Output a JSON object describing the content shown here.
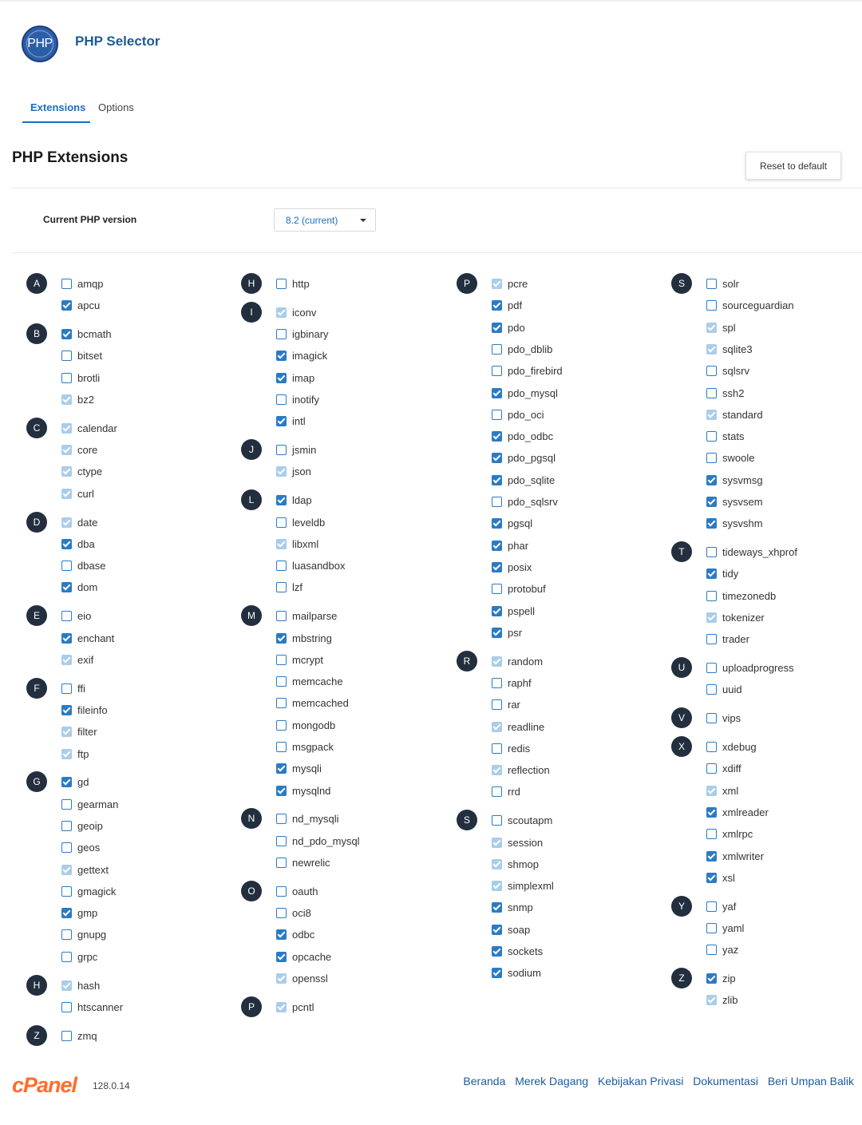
{
  "header": {
    "app_title": "PHP Selector",
    "logo_text": "PHP"
  },
  "tabs": [
    {
      "label": "Extensions",
      "active": true
    },
    {
      "label": "Options",
      "active": false
    }
  ],
  "section_title": "PHP Extensions",
  "reset_button": "Reset to default",
  "version": {
    "label": "Current PHP version",
    "selected": "8.2 (current)"
  },
  "columns": [
    [
      {
        "letter": "A",
        "items": [
          {
            "name": "amqp",
            "state": "unchecked"
          },
          {
            "name": "apcu",
            "state": "checked"
          }
        ]
      },
      {
        "letter": "B",
        "items": [
          {
            "name": "bcmath",
            "state": "checked"
          },
          {
            "name": "bitset",
            "state": "unchecked"
          },
          {
            "name": "brotli",
            "state": "unchecked"
          },
          {
            "name": "bz2",
            "state": "checked-disabled"
          }
        ]
      },
      {
        "letter": "C",
        "items": [
          {
            "name": "calendar",
            "state": "checked-disabled"
          },
          {
            "name": "core",
            "state": "checked-disabled"
          },
          {
            "name": "ctype",
            "state": "checked-disabled"
          },
          {
            "name": "curl",
            "state": "checked-disabled"
          }
        ]
      },
      {
        "letter": "D",
        "items": [
          {
            "name": "date",
            "state": "checked-disabled"
          },
          {
            "name": "dba",
            "state": "checked"
          },
          {
            "name": "dbase",
            "state": "unchecked"
          },
          {
            "name": "dom",
            "state": "checked"
          }
        ]
      },
      {
        "letter": "E",
        "items": [
          {
            "name": "eio",
            "state": "unchecked"
          },
          {
            "name": "enchant",
            "state": "checked"
          },
          {
            "name": "exif",
            "state": "checked-disabled"
          }
        ]
      },
      {
        "letter": "F",
        "items": [
          {
            "name": "ffi",
            "state": "unchecked"
          },
          {
            "name": "fileinfo",
            "state": "checked"
          },
          {
            "name": "filter",
            "state": "checked-disabled"
          },
          {
            "name": "ftp",
            "state": "checked-disabled"
          }
        ]
      },
      {
        "letter": "G",
        "items": [
          {
            "name": "gd",
            "state": "checked"
          },
          {
            "name": "gearman",
            "state": "unchecked"
          },
          {
            "name": "geoip",
            "state": "unchecked"
          },
          {
            "name": "geos",
            "state": "unchecked"
          },
          {
            "name": "gettext",
            "state": "checked-disabled"
          },
          {
            "name": "gmagick",
            "state": "unchecked"
          },
          {
            "name": "gmp",
            "state": "checked"
          },
          {
            "name": "gnupg",
            "state": "unchecked"
          },
          {
            "name": "grpc",
            "state": "unchecked"
          }
        ]
      },
      {
        "letter": "H",
        "items": [
          {
            "name": "hash",
            "state": "checked-disabled"
          },
          {
            "name": "htscanner",
            "state": "unchecked"
          }
        ]
      },
      {
        "letter": "Z",
        "items": [
          {
            "name": "zmq",
            "state": "unchecked"
          }
        ]
      }
    ],
    [
      {
        "letter": "H",
        "items": [
          {
            "name": "http",
            "state": "unchecked"
          }
        ]
      },
      {
        "letter": "I",
        "items": [
          {
            "name": "iconv",
            "state": "checked-disabled"
          },
          {
            "name": "igbinary",
            "state": "unchecked"
          },
          {
            "name": "imagick",
            "state": "checked"
          },
          {
            "name": "imap",
            "state": "checked"
          },
          {
            "name": "inotify",
            "state": "unchecked"
          },
          {
            "name": "intl",
            "state": "checked"
          }
        ]
      },
      {
        "letter": "J",
        "items": [
          {
            "name": "jsmin",
            "state": "unchecked"
          },
          {
            "name": "json",
            "state": "checked-disabled"
          }
        ]
      },
      {
        "letter": "L",
        "items": [
          {
            "name": "ldap",
            "state": "checked"
          },
          {
            "name": "leveldb",
            "state": "unchecked"
          },
          {
            "name": "libxml",
            "state": "checked-disabled"
          },
          {
            "name": "luasandbox",
            "state": "unchecked"
          },
          {
            "name": "lzf",
            "state": "unchecked"
          }
        ]
      },
      {
        "letter": "M",
        "items": [
          {
            "name": "mailparse",
            "state": "unchecked"
          },
          {
            "name": "mbstring",
            "state": "checked"
          },
          {
            "name": "mcrypt",
            "state": "unchecked"
          },
          {
            "name": "memcache",
            "state": "unchecked"
          },
          {
            "name": "memcached",
            "state": "unchecked"
          },
          {
            "name": "mongodb",
            "state": "unchecked"
          },
          {
            "name": "msgpack",
            "state": "unchecked"
          },
          {
            "name": "mysqli",
            "state": "checked"
          },
          {
            "name": "mysqlnd",
            "state": "checked"
          }
        ]
      },
      {
        "letter": "N",
        "items": [
          {
            "name": "nd_mysqli",
            "state": "unchecked"
          },
          {
            "name": "nd_pdo_mysql",
            "state": "unchecked"
          },
          {
            "name": "newrelic",
            "state": "unchecked"
          }
        ]
      },
      {
        "letter": "O",
        "items": [
          {
            "name": "oauth",
            "state": "unchecked"
          },
          {
            "name": "oci8",
            "state": "unchecked"
          },
          {
            "name": "odbc",
            "state": "checked"
          },
          {
            "name": "opcache",
            "state": "checked"
          },
          {
            "name": "openssl",
            "state": "checked-disabled"
          }
        ]
      },
      {
        "letter": "P",
        "items": [
          {
            "name": "pcntl",
            "state": "checked-disabled"
          }
        ]
      }
    ],
    [
      {
        "letter": "P",
        "items": [
          {
            "name": "pcre",
            "state": "checked-disabled"
          },
          {
            "name": "pdf",
            "state": "checked"
          },
          {
            "name": "pdo",
            "state": "checked"
          },
          {
            "name": "pdo_dblib",
            "state": "unchecked"
          },
          {
            "name": "pdo_firebird",
            "state": "unchecked"
          },
          {
            "name": "pdo_mysql",
            "state": "checked"
          },
          {
            "name": "pdo_oci",
            "state": "unchecked"
          },
          {
            "name": "pdo_odbc",
            "state": "checked"
          },
          {
            "name": "pdo_pgsql",
            "state": "checked"
          },
          {
            "name": "pdo_sqlite",
            "state": "checked"
          },
          {
            "name": "pdo_sqlsrv",
            "state": "unchecked"
          },
          {
            "name": "pgsql",
            "state": "checked"
          },
          {
            "name": "phar",
            "state": "checked"
          },
          {
            "name": "posix",
            "state": "checked"
          },
          {
            "name": "protobuf",
            "state": "unchecked"
          },
          {
            "name": "pspell",
            "state": "checked"
          },
          {
            "name": "psr",
            "state": "checked"
          }
        ]
      },
      {
        "letter": "R",
        "items": [
          {
            "name": "random",
            "state": "checked-disabled"
          },
          {
            "name": "raphf",
            "state": "unchecked"
          },
          {
            "name": "rar",
            "state": "unchecked"
          },
          {
            "name": "readline",
            "state": "checked-disabled"
          },
          {
            "name": "redis",
            "state": "unchecked"
          },
          {
            "name": "reflection",
            "state": "checked-disabled"
          },
          {
            "name": "rrd",
            "state": "unchecked"
          }
        ]
      },
      {
        "letter": "S",
        "items": [
          {
            "name": "scoutapm",
            "state": "unchecked"
          },
          {
            "name": "session",
            "state": "checked-disabled"
          },
          {
            "name": "shmop",
            "state": "checked-disabled"
          },
          {
            "name": "simplexml",
            "state": "checked-disabled"
          },
          {
            "name": "snmp",
            "state": "checked"
          },
          {
            "name": "soap",
            "state": "checked"
          },
          {
            "name": "sockets",
            "state": "checked"
          },
          {
            "name": "sodium",
            "state": "checked"
          }
        ]
      }
    ],
    [
      {
        "letter": "S",
        "items": [
          {
            "name": "solr",
            "state": "unchecked"
          },
          {
            "name": "sourceguardian",
            "state": "unchecked"
          },
          {
            "name": "spl",
            "state": "checked-disabled"
          },
          {
            "name": "sqlite3",
            "state": "checked-disabled"
          },
          {
            "name": "sqlsrv",
            "state": "unchecked"
          },
          {
            "name": "ssh2",
            "state": "unchecked"
          },
          {
            "name": "standard",
            "state": "checked-disabled"
          },
          {
            "name": "stats",
            "state": "unchecked"
          },
          {
            "name": "swoole",
            "state": "unchecked"
          },
          {
            "name": "sysvmsg",
            "state": "checked"
          },
          {
            "name": "sysvsem",
            "state": "checked"
          },
          {
            "name": "sysvshm",
            "state": "checked"
          }
        ]
      },
      {
        "letter": "T",
        "items": [
          {
            "name": "tideways_xhprof",
            "state": "unchecked"
          },
          {
            "name": "tidy",
            "state": "checked"
          },
          {
            "name": "timezonedb",
            "state": "unchecked"
          },
          {
            "name": "tokenizer",
            "state": "checked-disabled"
          },
          {
            "name": "trader",
            "state": "unchecked"
          }
        ]
      },
      {
        "letter": "U",
        "items": [
          {
            "name": "uploadprogress",
            "state": "unchecked"
          },
          {
            "name": "uuid",
            "state": "unchecked"
          }
        ]
      },
      {
        "letter": "V",
        "items": [
          {
            "name": "vips",
            "state": "unchecked"
          }
        ]
      },
      {
        "letter": "X",
        "items": [
          {
            "name": "xdebug",
            "state": "unchecked"
          },
          {
            "name": "xdiff",
            "state": "unchecked"
          },
          {
            "name": "xml",
            "state": "checked-disabled"
          },
          {
            "name": "xmlreader",
            "state": "checked"
          },
          {
            "name": "xmlrpc",
            "state": "unchecked"
          },
          {
            "name": "xmlwriter",
            "state": "checked"
          },
          {
            "name": "xsl",
            "state": "checked"
          }
        ]
      },
      {
        "letter": "Y",
        "items": [
          {
            "name": "yaf",
            "state": "unchecked"
          },
          {
            "name": "yaml",
            "state": "unchecked"
          },
          {
            "name": "yaz",
            "state": "unchecked"
          }
        ]
      },
      {
        "letter": "Z",
        "items": [
          {
            "name": "zip",
            "state": "checked"
          },
          {
            "name": "zlib",
            "state": "checked-disabled"
          }
        ]
      }
    ]
  ],
  "footer": {
    "brand": "cPanel",
    "version": "128.0.14",
    "links": [
      "Beranda",
      "Merek Dagang",
      "Kebijakan Privasi",
      "Dokumentasi",
      "Beri Umpan Balik"
    ]
  },
  "colors": {
    "accent": "#1a6ec1",
    "checkbox": "#2b7bc4",
    "checkbox_disabled": "#a9cdea",
    "letter_badge": "#232f3e",
    "brand": "#ff6c2c"
  }
}
